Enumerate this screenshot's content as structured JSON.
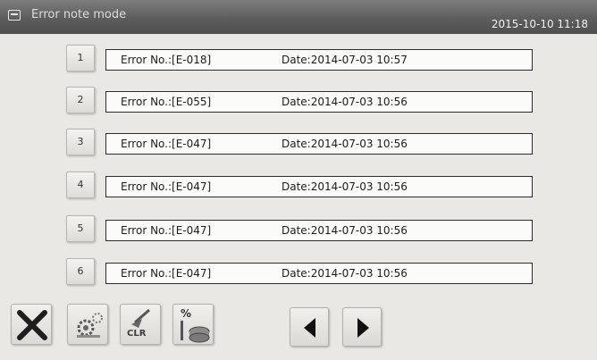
{
  "header": {
    "title": "Error note mode",
    "datetime": "2015-10-10 11:18"
  },
  "errors": [
    {
      "index": "1",
      "code": "Error No.:[E-018]",
      "date": "Date:2014-07-03  10:57"
    },
    {
      "index": "2",
      "code": "Error No.:[E-055]",
      "date": "Date:2014-07-03  10:56"
    },
    {
      "index": "3",
      "code": "Error No.:[E-047]",
      "date": "Date:2014-07-03  10:56"
    },
    {
      "index": "4",
      "code": "Error No.:[E-047]",
      "date": "Date:2014-07-03  10:56"
    },
    {
      "index": "5",
      "code": "Error No.:[E-047]",
      "date": "Date:2014-07-03  10:56"
    },
    {
      "index": "6",
      "code": "Error No.:[E-047]",
      "date": "Date:2014-07-03  10:56"
    }
  ],
  "toolbar": {
    "clr_label": "CLR",
    "percent_label": "%",
    "icons": [
      "close-icon",
      "settings-icon",
      "clear-icon",
      "counter-icon",
      "arrow-left-icon",
      "arrow-right-icon"
    ]
  },
  "colors": {
    "titlebar": "#5d5d5d",
    "background": "#eae8e4",
    "field_border": "#2d2d2d"
  }
}
